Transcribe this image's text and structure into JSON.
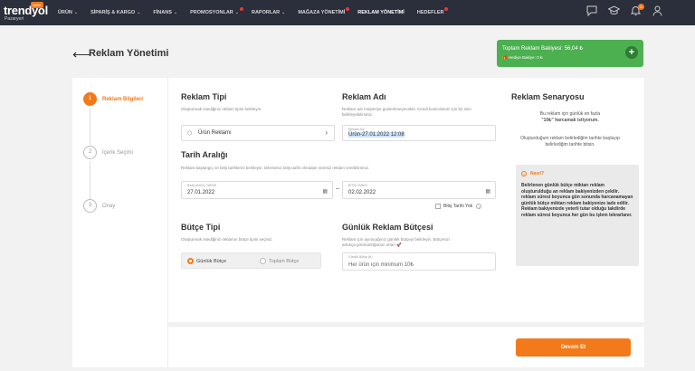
{
  "brand": {
    "name": "trendyol",
    "badge": "seller",
    "sub": "Pazaryeri"
  },
  "nav": [
    {
      "label": "ÜRÜN",
      "chevron": true,
      "dot": false
    },
    {
      "label": "SİPARİŞ & KARGO",
      "chevron": true,
      "dot": false
    },
    {
      "label": "FİNANS",
      "chevron": true,
      "dot": false
    },
    {
      "label": "PROMOSYONLAR",
      "chevron": true,
      "dot": true
    },
    {
      "label": "RAPORLAR",
      "chevron": true,
      "dot": false
    },
    {
      "label": "MAĞAZA YÖNETİMİ",
      "chevron": false,
      "dot": true
    },
    {
      "label": "REKLAM YÖNETİMİ",
      "chevron": false,
      "dot": false
    },
    {
      "label": "HEDEFLER",
      "chevron": false,
      "dot": true
    }
  ],
  "top_icons": {
    "notification_count": "5"
  },
  "header": {
    "title": "Reklam Yönetimi",
    "balance_line1": "Toplam Reklam Bakiyesi: 56,04 ₺",
    "balance_line2": "Hediye Bakiye: 0 ₺"
  },
  "steps": [
    {
      "num": "1",
      "label": "Reklam Bilgileri"
    },
    {
      "num": "2",
      "label": "İçerik Seçimi"
    },
    {
      "num": "3",
      "label": "Onay"
    }
  ],
  "form": {
    "ad_type": {
      "title": "Reklam Tipi",
      "desc": "Oluşturmak istediğiniz reklam tipini belirleyin.",
      "value": "Ürün Reklamı"
    },
    "ad_name": {
      "title": "Reklam Adı",
      "desc": "Reklam adı müşteriye gösterilmeyecektir. Kendi kontrolünüz için bir isim belirleyebilirsiniz.",
      "label": "Reklam Adı",
      "value": "Ürün-27.01.2022 12:08"
    },
    "date_range": {
      "title": "Tarih Aralığı",
      "desc": "Reklam başlangıç ve bitiş tarihlerini belirleyin. Dilerseniz bitiş tarihi olmadan süresiz reklam verebilirsiniz.",
      "start_label": "BAŞLANGIÇ TARİHİ",
      "start_value": "27.01.2022",
      "end_label": "BİTİŞ TARİHİ",
      "end_value": "02.02.2022",
      "no_end_label": "Bitiş Tarihi Yok"
    },
    "budget_type": {
      "title": "Bütçe Tipi",
      "desc": "Oluşturmak istediğiniz reklamın bütçe tipini seçiniz.",
      "option1": "Günlük Bütçe",
      "option2": "Toplam Bütçe"
    },
    "daily_budget": {
      "title": "Günlük Reklam Bütçesi",
      "desc1": "Reklam için ayıracağınız günlük bütçeyi belirleyin. Bütçenizi",
      "desc2": "arttıkça görünürlüğünüz artar! 🚀",
      "label": "Günlük Bütçe (₺)",
      "placeholder": "Her ürün için minimum 10₺"
    }
  },
  "scenario": {
    "title": "Reklam Senaryosu",
    "p1a": "Bu reklam için günlük en fazla",
    "p1b": "\"10₺\" harcamak istiyorum.",
    "p2": "Oluşturduğum reklam belirlediğim tarihte başlayıp belirlediğim tarihte bitsin.",
    "how_title": "Nasıl?",
    "how_body": "Belirlenen günlük bütçe miktarı reklam oluşturulduğu an reklam bakiyenizden çekilir. reklam süresi boyunca gün sonunda harcanamayan günlük bütçe miktarı reklam bakiyenize iade edilir. Reklam bakiyenizde yeterli tutar olduğu takdirde reklam süresi boyunca her gün bu işlem tekrarlanır."
  },
  "footer": {
    "continue_label": "Devam Et"
  },
  "colors": {
    "accent": "#f27a1a",
    "nav_bg": "#2b2e3b",
    "balance_bg": "#4caf50"
  }
}
